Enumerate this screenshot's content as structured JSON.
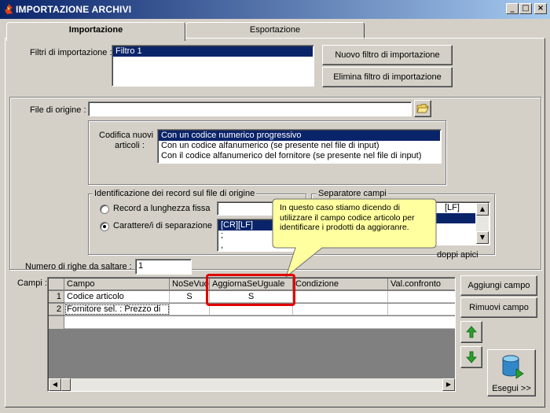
{
  "window": {
    "title": "IMPORTAZIONE ARCHIVI",
    "minimize": "_",
    "maximize": "□",
    "close": "×"
  },
  "tabs": [
    {
      "label": "Importazione",
      "active": true
    },
    {
      "label": "Esportazione",
      "active": false
    }
  ],
  "filters": {
    "label": "Filtri di importazione :",
    "items": [
      "Filtro 1"
    ],
    "new_button": "Nuovo filtro di importazione",
    "delete_button": "Elimina filtro di importazione"
  },
  "source_file": {
    "label": "File di origine :",
    "value": ""
  },
  "codifica": {
    "label_line1": "Codifica nuovi",
    "label_line2": "articoli :",
    "options": [
      "Con un codice numerico progressivo",
      "Con un codice alfanumerico (se presente nel file di input)",
      "Con il codice alfanumerico del fornitore (se presente nel file di input)"
    ],
    "selected_index": 0
  },
  "identificazione": {
    "title": "Identificazione dei record sul file di origine",
    "fixed_length": "Record a lunghezza fissa",
    "separator": "Carattere/i di separazione",
    "selected": "separator",
    "sep_list": [
      "[CR][LF]",
      ";",
      ","
    ]
  },
  "separatore": {
    "title": "Separatore campi",
    "list": [
      "[LF]",
      ""
    ],
    "double_quotes": "doppi apici"
  },
  "skip_rows": {
    "label": "Numero di righe da saltare :",
    "value": "1"
  },
  "campi": {
    "label": "Campi :",
    "headers": [
      "Campo",
      "NoSeVuoto",
      "AggiornaSeUguale",
      "Condizione",
      "Val.confronto"
    ],
    "rows": [
      {
        "num": "1",
        "campo": "Codice articolo",
        "nosevuoto": "S",
        "aggiorna": "S",
        "condizione": "",
        "valconfronto": ""
      },
      {
        "num": "2",
        "campo": "Fornitore sel. : Prezzo di",
        "nosevuoto": "",
        "aggiorna": "",
        "condizione": "",
        "valconfronto": ""
      }
    ],
    "add_button": "Aggiungi campo",
    "remove_button": "Rimuovi campo",
    "run_button": "Esegui >>"
  },
  "tooltip": {
    "text": "In questo caso stiamo dicendo di utilizzare il campo codice articolo per identificare i prodotti da aggioranre."
  },
  "colors": {
    "titlebar": "#0a246a",
    "selection": "#0a246a",
    "tooltip_bg": "#ffffa0",
    "highlight_box": "#e00000",
    "arrow_green": "#2aa02a"
  }
}
